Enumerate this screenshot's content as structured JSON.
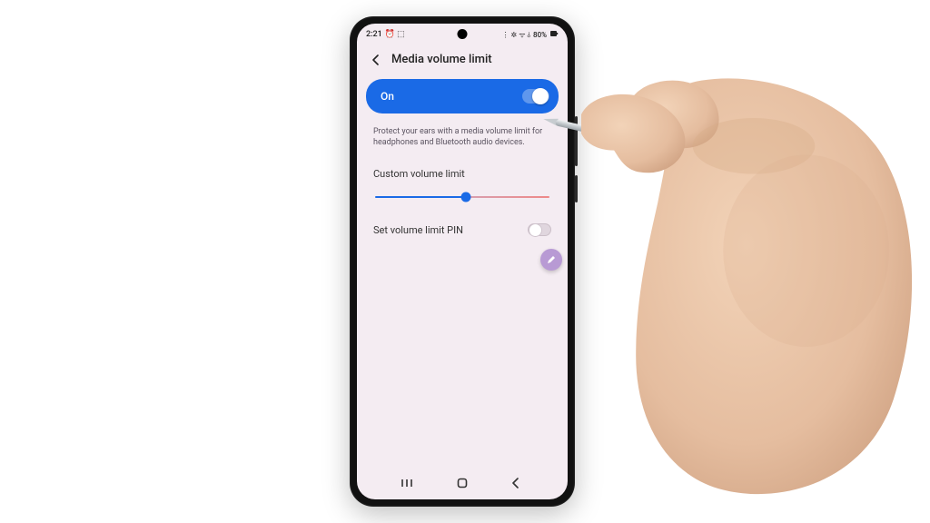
{
  "status": {
    "time": "2:21",
    "left_icons": "⏰ ⬚",
    "right_icons": "⋮ ✲ ᯤ ⫰",
    "battery": "80%"
  },
  "header": {
    "title": "Media volume limit"
  },
  "toggle": {
    "label": "On"
  },
  "description": "Protect your ears with a media volume limit for headphones and Bluetooth audio devices.",
  "slider": {
    "label": "Custom volume limit"
  },
  "pin": {
    "label": "Set volume limit PIN"
  }
}
